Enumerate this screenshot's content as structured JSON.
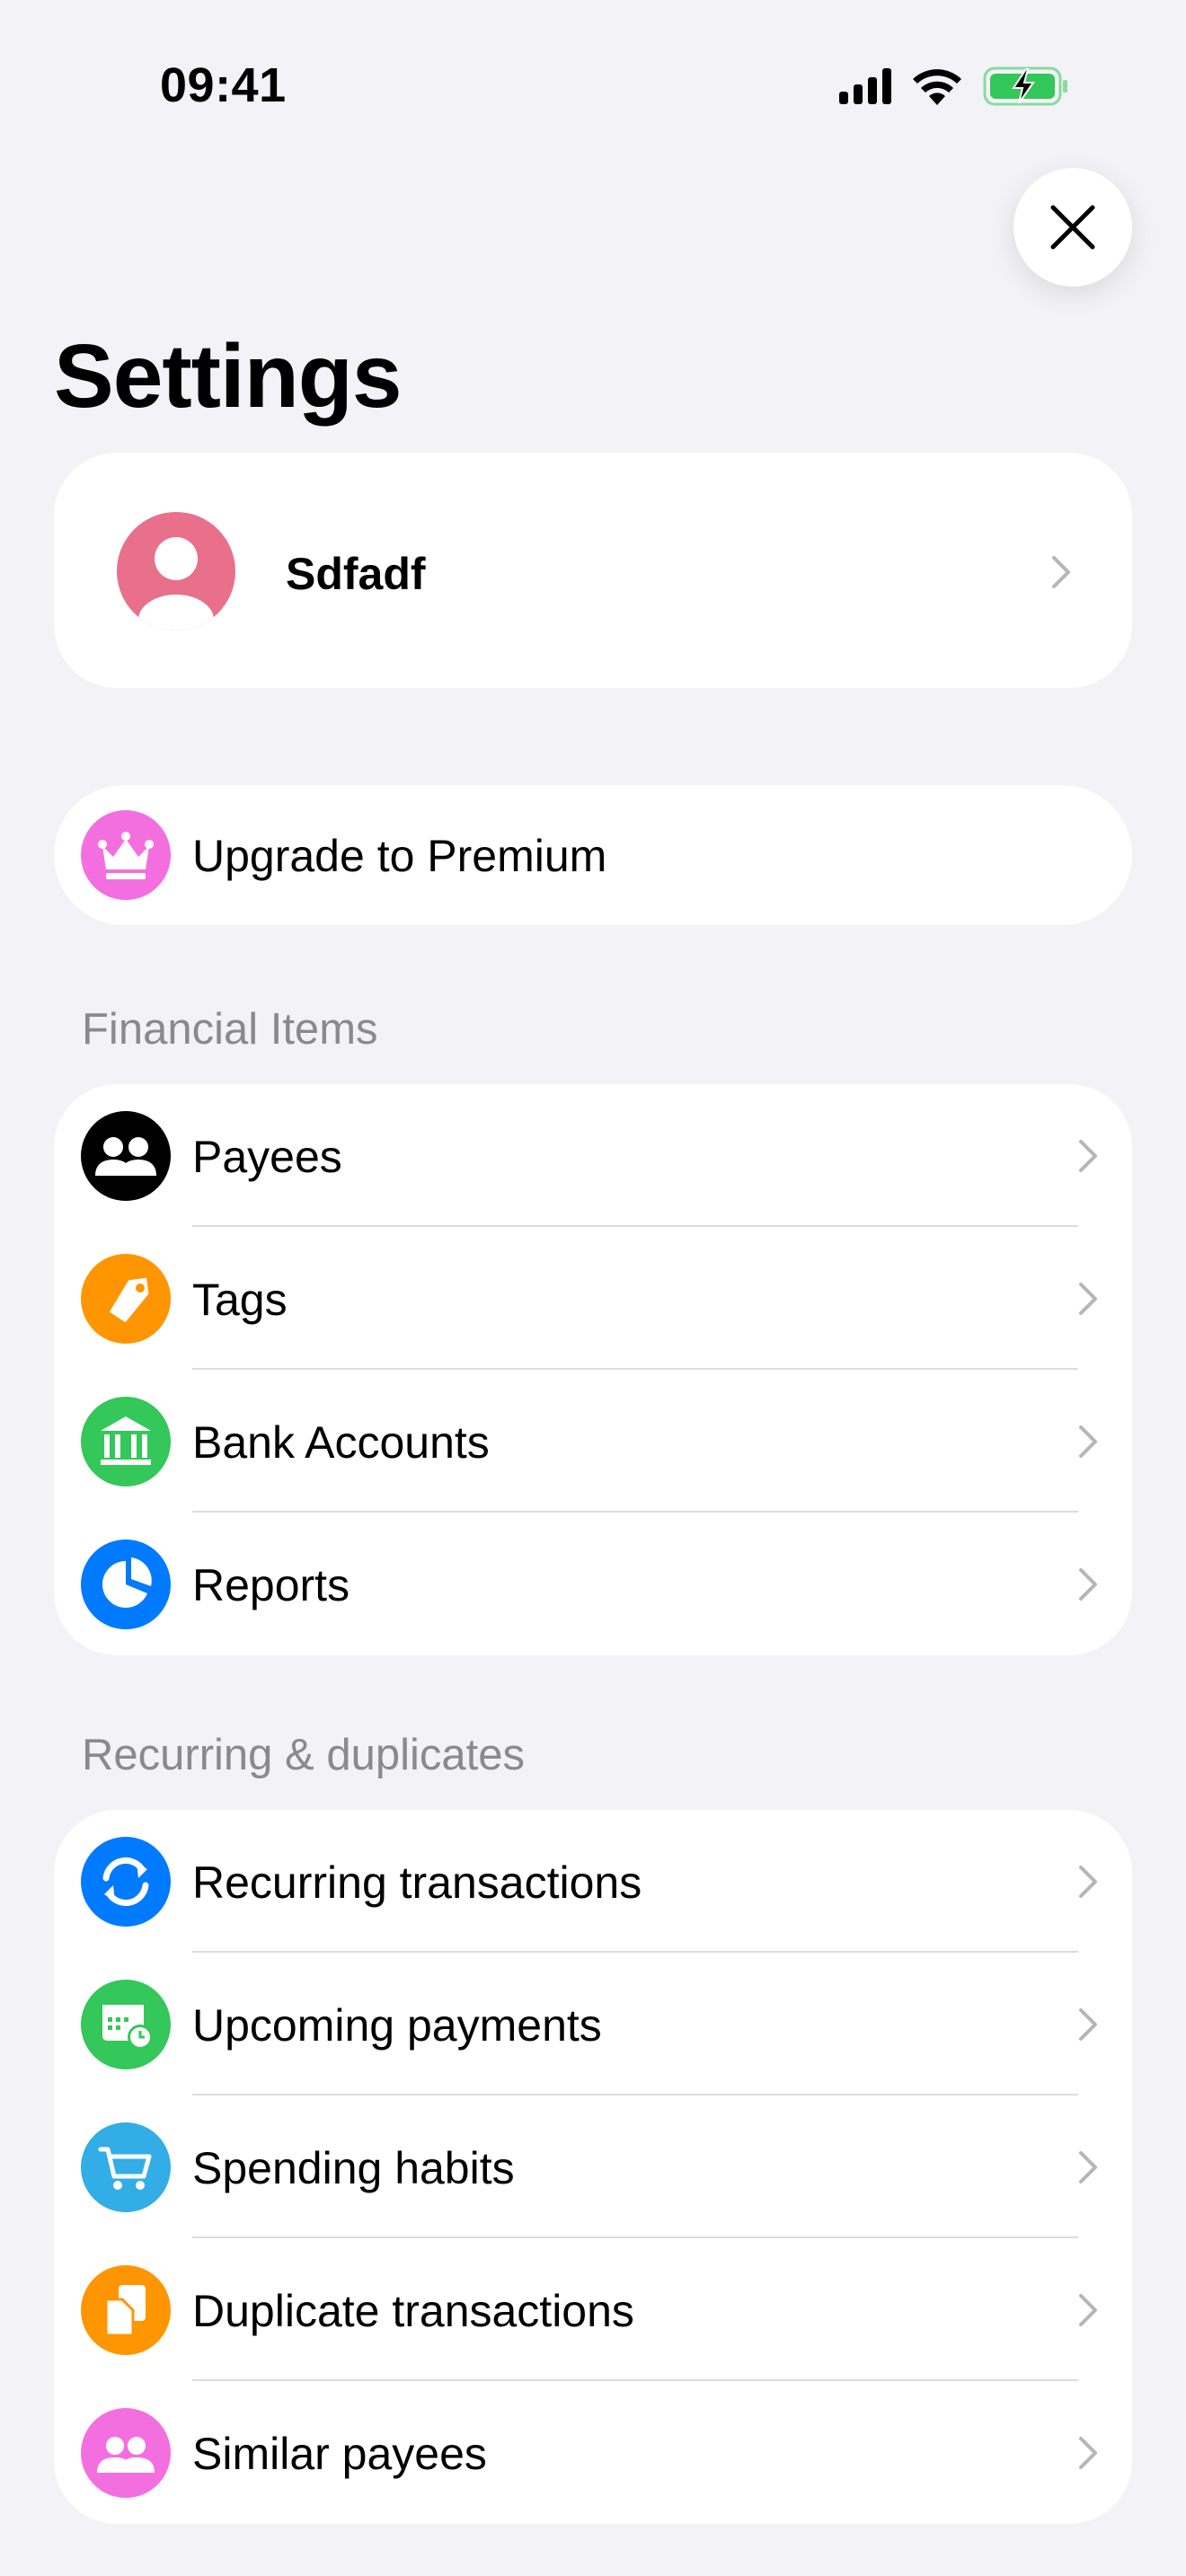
{
  "status_bar": {
    "time": "09:41"
  },
  "header": {
    "title": "Settings"
  },
  "profile": {
    "name": "Sdfadf"
  },
  "premium": {
    "label": "Upgrade to Premium"
  },
  "sections": {
    "financial": {
      "title": "Financial Items",
      "items": [
        {
          "label": "Payees",
          "icon": "people-icon",
          "color": "#000000"
        },
        {
          "label": "Tags",
          "icon": "tag-icon",
          "color": "#ff9500"
        },
        {
          "label": "Bank Accounts",
          "icon": "bank-icon",
          "color": "#34c759"
        },
        {
          "label": "Reports",
          "icon": "pie-chart-icon",
          "color": "#007aff"
        }
      ]
    },
    "recurring": {
      "title": "Recurring & duplicates",
      "items": [
        {
          "label": "Recurring transactions",
          "icon": "recurring-arrows-icon",
          "color": "#007aff"
        },
        {
          "label": "Upcoming payments",
          "icon": "calendar-clock-icon",
          "color": "#34c759"
        },
        {
          "label": "Spending habits",
          "icon": "cart-icon",
          "color": "#32ade6"
        },
        {
          "label": "Duplicate transactions",
          "icon": "duplicate-docs-icon",
          "color": "#ff9500"
        },
        {
          "label": "Similar payees",
          "icon": "similar-people-icon",
          "color": "#f36fe0"
        }
      ]
    }
  },
  "colors": {
    "background": "#f2f2f7",
    "avatar": "#e8708a",
    "premium": "#f36fe0",
    "battery": "#34c759"
  }
}
